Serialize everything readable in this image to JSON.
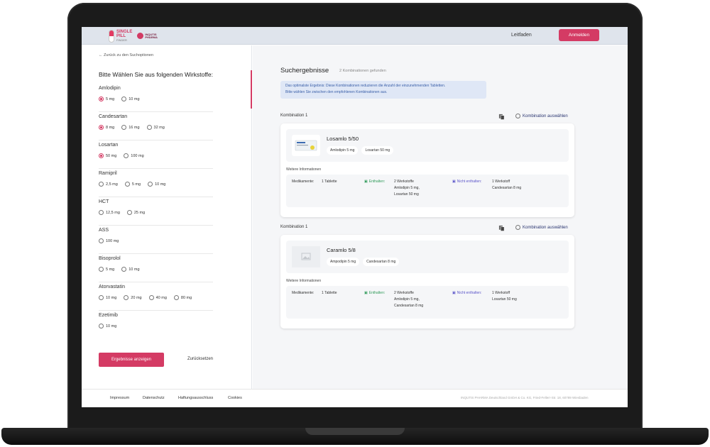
{
  "header": {
    "logo_line1": "SINGLE",
    "logo_line2": "PILL",
    "logo_finder": "FINDER",
    "partner_line1": "INQUTIS",
    "partner_line2": "PHARMA",
    "nav_link": "Leitfaden",
    "login_label": "Anmelden"
  },
  "left": {
    "back_label": "← Zurück zu den Suchoptionen",
    "title": "Bitte Wählen Sie aus folgenden Wirkstoffe:",
    "groups": [
      {
        "name": "Amlodipin",
        "options": [
          {
            "label": "5 mg",
            "checked": true
          },
          {
            "label": "10 mg",
            "checked": false
          }
        ]
      },
      {
        "name": "Candesartan",
        "options": [
          {
            "label": "8 mg",
            "checked": true
          },
          {
            "label": "16 mg",
            "checked": false
          },
          {
            "label": "32 mg",
            "checked": false
          }
        ]
      },
      {
        "name": "Losartan",
        "options": [
          {
            "label": "50 mg",
            "checked": true
          },
          {
            "label": "100 mg",
            "checked": false
          }
        ]
      },
      {
        "name": "Ramipril",
        "options": [
          {
            "label": "2,5 mg",
            "checked": false
          },
          {
            "label": "5 mg",
            "checked": false
          },
          {
            "label": "10 mg",
            "checked": false
          }
        ]
      },
      {
        "name": "HCT",
        "options": [
          {
            "label": "12,5 mg",
            "checked": false
          },
          {
            "label": "25 mg",
            "checked": false
          }
        ]
      },
      {
        "name": "ASS",
        "options": [
          {
            "label": "100 mg",
            "checked": false
          }
        ]
      },
      {
        "name": "Bisoprolol",
        "options": [
          {
            "label": "5 mg",
            "checked": false
          },
          {
            "label": "10 mg",
            "checked": false
          }
        ]
      },
      {
        "name": "Atorvastatin",
        "options": [
          {
            "label": "10 mg",
            "checked": false
          },
          {
            "label": "20 mg",
            "checked": false
          },
          {
            "label": "40 mg",
            "checked": false
          },
          {
            "label": "80 mg",
            "checked": false
          }
        ]
      },
      {
        "name": "Ezetimib",
        "options": [
          {
            "label": "10 mg",
            "checked": false
          }
        ]
      }
    ],
    "show_button": "Ergebnisse anzeigen",
    "reset_button": "Zurücksetzen"
  },
  "results": {
    "title": "Suchergebnisse",
    "count": "2 Kombinationen gefunden",
    "info_line1": "Das optimalste Ergebnis: Diese Kombinationen reduzieren die Anzahl der einzunehmenden Tabletten.",
    "info_line2": "Bitte wählen Sie zwischen den empfohlenen Kombinationen aus.",
    "select_label": "Kombination auswählen",
    "more_label": "Weitere Informationen",
    "med_label": "Medikamente:",
    "contains_label": "Enthalten:",
    "not_contains_label": "Nicht enthalten:",
    "combos": [
      {
        "label": "Kombination 1",
        "product": "Losamlo 5/50",
        "chips": [
          "Amlodipin 5 mg",
          "Losartan 50 mg"
        ],
        "med_value": "1 Tablette",
        "contains_count": "2 Werkstoffe",
        "contains_line1": "Amlodipin 5 mg,",
        "contains_line2": "Losartan 50 mg",
        "not_count": "1 Werkstoff",
        "not_line1": "Candesartan 8 mg"
      },
      {
        "label": "Kombination 1",
        "product": "Caramlo 5/8",
        "chips": [
          "Ampodipin 5 mg",
          "Candesartan 8 mg"
        ],
        "med_value": "1 Tablette",
        "contains_count": "2 Werkstoffe",
        "contains_line1": "Amlodipin 5 mg,",
        "contains_line2": "Candesartan 8 mg",
        "not_count": "1 Werkstoff",
        "not_line1": "Losartan 50 mg"
      }
    ]
  },
  "footer": {
    "links": [
      "Impressum",
      "Datenschutz",
      "Haftungsausschluss",
      "Cookies"
    ],
    "copyright": "INQUTIS PHARMA Deutschland GmbH & Co. KG, Fried-Fellerr-Str. 18, 60789 Wiesbaden"
  },
  "colors": {
    "accent": "#d43b64",
    "info_bg": "#dfe7f6",
    "green": "#2f9a59",
    "violet": "#5b55c9"
  }
}
